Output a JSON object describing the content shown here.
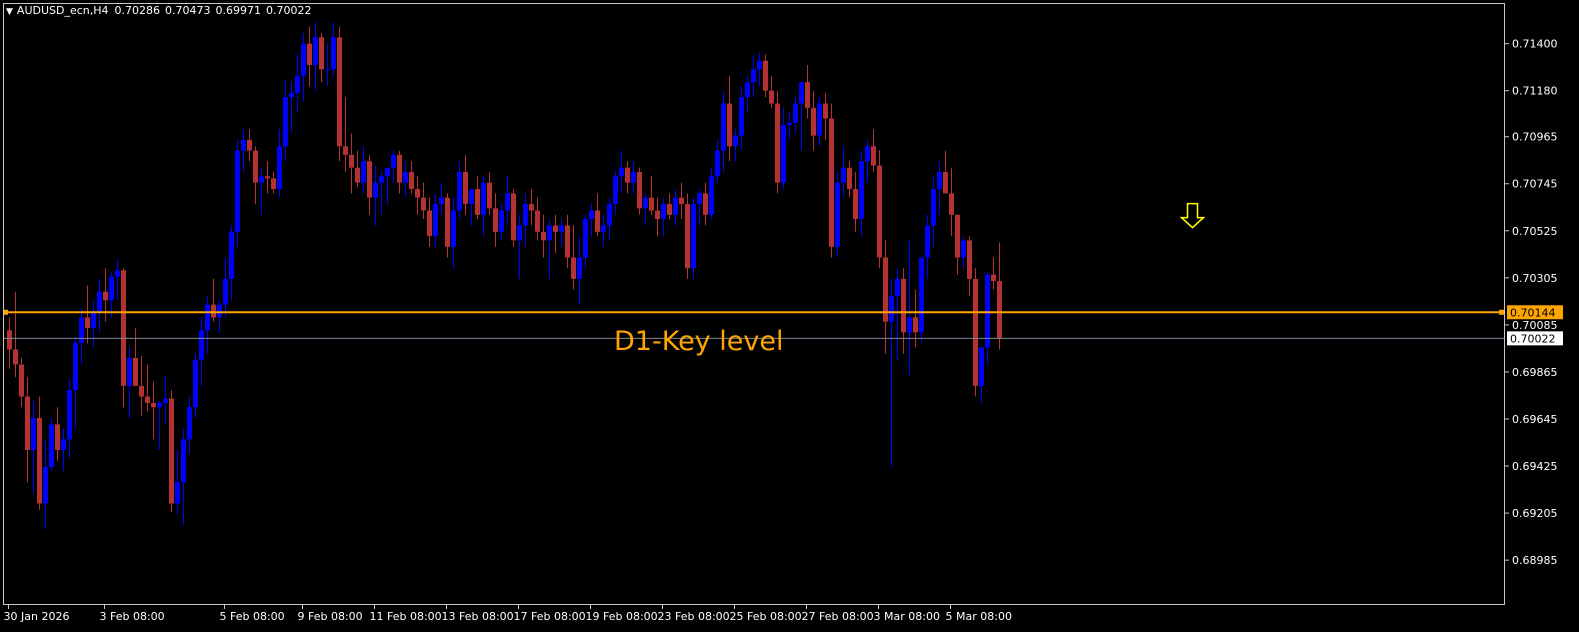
{
  "header": {
    "symbol": "AUDUSD_ecn,H4",
    "open": "0.70286",
    "high": "0.70473",
    "low": "0.69971",
    "close": "0.70022",
    "collapse_icon": "triangle-down-icon"
  },
  "colors": {
    "background": "#000000",
    "frame": "#c8c8c8",
    "bull": "#0000ff",
    "bear": "#b43232",
    "key_level": "#ffa500",
    "current_price": "#7d8a99",
    "arrow": "#ffff00",
    "text": "#ffffff"
  },
  "annotation": {
    "key_level_text": "D1-Key level",
    "arrow_icon": "arrow-down-outline-icon"
  },
  "price_tags": {
    "key_level": "0.70144",
    "current": "0.70022"
  },
  "chart_data": {
    "type": "candlestick",
    "title": "AUDUSD_ecn,H4",
    "ylim": [
      0.6878,
      0.7159
    ],
    "y_ticks": [
      "0.71400",
      "0.71180",
      "0.70965",
      "0.70745",
      "0.70525",
      "0.70305",
      "0.70085",
      "0.69865",
      "0.69645",
      "0.69425",
      "0.69205",
      "0.68985"
    ],
    "x_ticks": [
      "30 Jan 2026",
      "3 Feb 08:00",
      "5 Feb 08:00",
      "9 Feb 08:00",
      "11 Feb 08:00",
      "13 Feb 08:00",
      "17 Feb 08:00",
      "19 Feb 08:00",
      "23 Feb 08:00",
      "25 Feb 08:00",
      "27 Feb 08:00",
      "3 Mar 08:00",
      "5 Mar 08:00"
    ],
    "x_tick_bar_index": [
      0,
      16,
      36,
      49,
      61,
      73,
      85,
      97,
      109,
      121,
      133,
      145,
      157
    ],
    "grid": false,
    "horizontal_lines": [
      {
        "name": "D1-Key level",
        "price": 0.70144
      },
      {
        "name": "current price",
        "price": 0.70022
      }
    ],
    "arrow_marker": {
      "bar_index": 198,
      "price": 0.7054,
      "direction": "down"
    },
    "candles": [
      [
        0.7006,
        0.7012,
        0.6988,
        0.6997
      ],
      [
        0.6997,
        0.7024,
        0.6984,
        0.699
      ],
      [
        0.699,
        0.6993,
        0.697,
        0.6975
      ],
      [
        0.6975,
        0.6984,
        0.6935,
        0.695
      ],
      [
        0.695,
        0.6973,
        0.693,
        0.6965
      ],
      [
        0.6965,
        0.6975,
        0.6922,
        0.6925
      ],
      [
        0.6925,
        0.6955,
        0.6913,
        0.6942
      ],
      [
        0.6942,
        0.6965,
        0.694,
        0.6962
      ],
      [
        0.6962,
        0.697,
        0.6945,
        0.695
      ],
      [
        0.695,
        0.696,
        0.694,
        0.6955
      ],
      [
        0.6955,
        0.6983,
        0.6946,
        0.6978
      ],
      [
        0.6978,
        0.7003,
        0.696,
        0.7
      ],
      [
        0.7,
        0.7016,
        0.699,
        0.7012
      ],
      [
        0.7012,
        0.7027,
        0.7,
        0.7007
      ],
      [
        0.7007,
        0.702,
        0.6998,
        0.7015
      ],
      [
        0.7015,
        0.703,
        0.7005,
        0.7024
      ],
      [
        0.7024,
        0.7035,
        0.701,
        0.702
      ],
      [
        0.702,
        0.7033,
        0.7012,
        0.7031
      ],
      [
        0.7031,
        0.7039,
        0.702,
        0.7034
      ],
      [
        0.7034,
        0.7035,
        0.697,
        0.698
      ],
      [
        0.698,
        0.6998,
        0.6965,
        0.6993
      ],
      [
        0.6993,
        0.7007,
        0.6982,
        0.698
      ],
      [
        0.698,
        0.6994,
        0.6966,
        0.6975
      ],
      [
        0.6975,
        0.699,
        0.6968,
        0.6972
      ],
      [
        0.6972,
        0.6982,
        0.6955,
        0.697
      ],
      [
        0.697,
        0.6973,
        0.695,
        0.6972
      ],
      [
        0.6972,
        0.6985,
        0.6962,
        0.6974
      ],
      [
        0.6974,
        0.6978,
        0.6921,
        0.6925
      ],
      [
        0.6925,
        0.695,
        0.692,
        0.6935
      ],
      [
        0.6935,
        0.696,
        0.6915,
        0.6955
      ],
      [
        0.6955,
        0.6975,
        0.6948,
        0.697
      ],
      [
        0.697,
        0.6995,
        0.6965,
        0.6992
      ],
      [
        0.6992,
        0.7012,
        0.698,
        0.7006
      ],
      [
        0.7006,
        0.7022,
        0.6995,
        0.7018
      ],
      [
        0.7018,
        0.703,
        0.701,
        0.7012
      ],
      [
        0.7012,
        0.702,
        0.7005,
        0.7018
      ],
      [
        0.7018,
        0.704,
        0.7012,
        0.703
      ],
      [
        0.703,
        0.7055,
        0.702,
        0.7052
      ],
      [
        0.7052,
        0.7095,
        0.7045,
        0.709
      ],
      [
        0.709,
        0.71,
        0.708,
        0.7095
      ],
      [
        0.7095,
        0.71,
        0.7085,
        0.709
      ],
      [
        0.709,
        0.7092,
        0.7065,
        0.7075
      ],
      [
        0.7075,
        0.7082,
        0.706,
        0.7078
      ],
      [
        0.7078,
        0.7085,
        0.707,
        0.7077
      ],
      [
        0.7077,
        0.708,
        0.707,
        0.7072
      ],
      [
        0.7072,
        0.71,
        0.7068,
        0.7092
      ],
      [
        0.7092,
        0.7123,
        0.7085,
        0.7115
      ],
      [
        0.7115,
        0.7122,
        0.7098,
        0.7117
      ],
      [
        0.7117,
        0.7135,
        0.7108,
        0.7125
      ],
      [
        0.7125,
        0.7145,
        0.7113,
        0.714
      ],
      [
        0.714,
        0.7148,
        0.712,
        0.713
      ],
      [
        0.713,
        0.715,
        0.7118,
        0.7143
      ],
      [
        0.7143,
        0.7145,
        0.7122,
        0.7128
      ],
      [
        0.7128,
        0.714,
        0.712,
        0.7128
      ],
      [
        0.7128,
        0.715,
        0.7125,
        0.7143
      ],
      [
        0.7143,
        0.7148,
        0.7085,
        0.7092
      ],
      [
        0.7092,
        0.7115,
        0.708,
        0.7088
      ],
      [
        0.7088,
        0.7098,
        0.707,
        0.7082
      ],
      [
        0.7082,
        0.709,
        0.7073,
        0.7075
      ],
      [
        0.7075,
        0.7092,
        0.707,
        0.7085
      ],
      [
        0.7085,
        0.7088,
        0.706,
        0.7068
      ],
      [
        0.7068,
        0.7083,
        0.7055,
        0.7075
      ],
      [
        0.7075,
        0.708,
        0.706,
        0.7078
      ],
      [
        0.7078,
        0.7082,
        0.7065,
        0.7082
      ],
      [
        0.7082,
        0.709,
        0.7075,
        0.7088
      ],
      [
        0.7088,
        0.709,
        0.707,
        0.7075
      ],
      [
        0.7075,
        0.7085,
        0.7068,
        0.708
      ],
      [
        0.708,
        0.7085,
        0.707,
        0.7072
      ],
      [
        0.7072,
        0.7078,
        0.706,
        0.7068
      ],
      [
        0.7068,
        0.7075,
        0.7058,
        0.7062
      ],
      [
        0.7062,
        0.7068,
        0.7045,
        0.705
      ],
      [
        0.705,
        0.707,
        0.7045,
        0.7065
      ],
      [
        0.7065,
        0.7075,
        0.706,
        0.7068
      ],
      [
        0.7068,
        0.707,
        0.704,
        0.7045
      ],
      [
        0.7045,
        0.7068,
        0.7035,
        0.7062
      ],
      [
        0.7062,
        0.7085,
        0.7058,
        0.708
      ],
      [
        0.708,
        0.7088,
        0.706,
        0.7065
      ],
      [
        0.7065,
        0.7072,
        0.7055,
        0.7072
      ],
      [
        0.7072,
        0.7078,
        0.7058,
        0.706
      ],
      [
        0.706,
        0.7078,
        0.705,
        0.7075
      ],
      [
        0.7075,
        0.708,
        0.706,
        0.7063
      ],
      [
        0.7063,
        0.707,
        0.7045,
        0.7052
      ],
      [
        0.7052,
        0.7065,
        0.7048,
        0.7062
      ],
      [
        0.7062,
        0.7078,
        0.7055,
        0.707
      ],
      [
        0.707,
        0.7072,
        0.7045,
        0.7048
      ],
      [
        0.7048,
        0.706,
        0.703,
        0.7055
      ],
      [
        0.7055,
        0.707,
        0.7045,
        0.7065
      ],
      [
        0.7065,
        0.7072,
        0.7055,
        0.7062
      ],
      [
        0.7062,
        0.7068,
        0.7048,
        0.7052
      ],
      [
        0.7052,
        0.706,
        0.704,
        0.7048
      ],
      [
        0.7048,
        0.7058,
        0.703,
        0.7055
      ],
      [
        0.7055,
        0.706,
        0.7042,
        0.7052
      ],
      [
        0.7052,
        0.7058,
        0.7045,
        0.7055
      ],
      [
        0.7055,
        0.706,
        0.7035,
        0.704
      ],
      [
        0.704,
        0.7055,
        0.7025,
        0.703
      ],
      [
        0.703,
        0.705,
        0.7018,
        0.704
      ],
      [
        0.704,
        0.706,
        0.7035,
        0.7058
      ],
      [
        0.7058,
        0.7065,
        0.705,
        0.7062
      ],
      [
        0.7062,
        0.707,
        0.705,
        0.7052
      ],
      [
        0.7052,
        0.706,
        0.7045,
        0.7055
      ],
      [
        0.7055,
        0.7068,
        0.7048,
        0.7065
      ],
      [
        0.7065,
        0.708,
        0.706,
        0.7078
      ],
      [
        0.7078,
        0.709,
        0.707,
        0.7082
      ],
      [
        0.7082,
        0.7085,
        0.707,
        0.7075
      ],
      [
        0.7075,
        0.7085,
        0.707,
        0.708
      ],
      [
        0.708,
        0.7082,
        0.706,
        0.7063
      ],
      [
        0.7063,
        0.707,
        0.7055,
        0.7068
      ],
      [
        0.7068,
        0.7078,
        0.706,
        0.7062
      ],
      [
        0.7062,
        0.7068,
        0.705,
        0.7058
      ],
      [
        0.7058,
        0.7068,
        0.705,
        0.7065
      ],
      [
        0.7065,
        0.707,
        0.7058,
        0.706
      ],
      [
        0.706,
        0.7072,
        0.7055,
        0.7068
      ],
      [
        0.7068,
        0.7075,
        0.7058,
        0.7065
      ],
      [
        0.7065,
        0.707,
        0.703,
        0.7035
      ],
      [
        0.7035,
        0.7068,
        0.703,
        0.7065
      ],
      [
        0.7065,
        0.7072,
        0.7055,
        0.707
      ],
      [
        0.707,
        0.7075,
        0.7055,
        0.706
      ],
      [
        0.706,
        0.7082,
        0.7058,
        0.7078
      ],
      [
        0.7078,
        0.7095,
        0.7075,
        0.709
      ],
      [
        0.709,
        0.7118,
        0.708,
        0.7112
      ],
      [
        0.7112,
        0.7125,
        0.7085,
        0.7092
      ],
      [
        0.7092,
        0.71,
        0.7085,
        0.7097
      ],
      [
        0.7097,
        0.712,
        0.709,
        0.7115
      ],
      [
        0.7115,
        0.7125,
        0.7108,
        0.7122
      ],
      [
        0.7122,
        0.7135,
        0.7115,
        0.7128
      ],
      [
        0.7128,
        0.7136,
        0.712,
        0.7132
      ],
      [
        0.7132,
        0.7135,
        0.7115,
        0.7118
      ],
      [
        0.7118,
        0.7125,
        0.711,
        0.7112
      ],
      [
        0.7112,
        0.7118,
        0.707,
        0.7075
      ],
      [
        0.7075,
        0.711,
        0.7072,
        0.7102
      ],
      [
        0.7102,
        0.7108,
        0.7095,
        0.7103
      ],
      [
        0.7103,
        0.7115,
        0.7098,
        0.7112
      ],
      [
        0.7112,
        0.7122,
        0.709,
        0.7122
      ],
      [
        0.7122,
        0.713,
        0.7105,
        0.711
      ],
      [
        0.711,
        0.7118,
        0.709,
        0.7097
      ],
      [
        0.7097,
        0.7115,
        0.7092,
        0.7112
      ],
      [
        0.7112,
        0.7117,
        0.7095,
        0.7105
      ],
      [
        0.7105,
        0.7112,
        0.704,
        0.7045
      ],
      [
        0.7045,
        0.708,
        0.704,
        0.7075
      ],
      [
        0.7075,
        0.7092,
        0.7068,
        0.7082
      ],
      [
        0.7082,
        0.7085,
        0.7068,
        0.7072
      ],
      [
        0.7072,
        0.708,
        0.7052,
        0.7058
      ],
      [
        0.7058,
        0.709,
        0.705,
        0.7085
      ],
      [
        0.7085,
        0.7095,
        0.7075,
        0.7092
      ],
      [
        0.7092,
        0.71,
        0.708,
        0.7083
      ],
      [
        0.7083,
        0.709,
        0.7035,
        0.704
      ],
      [
        0.704,
        0.7048,
        0.6995,
        0.701
      ],
      [
        0.701,
        0.703,
        0.6942,
        0.7022
      ],
      [
        0.7022,
        0.7035,
        0.6992,
        0.703
      ],
      [
        0.703,
        0.7035,
        0.6995,
        0.7005
      ],
      [
        0.7005,
        0.7048,
        0.6985,
        0.7012
      ],
      [
        0.7012,
        0.7025,
        0.6998,
        0.7005
      ],
      [
        0.7005,
        0.704,
        0.7,
        0.704
      ],
      [
        0.704,
        0.706,
        0.703,
        0.7055
      ],
      [
        0.7055,
        0.7078,
        0.7045,
        0.7072
      ],
      [
        0.7072,
        0.7085,
        0.706,
        0.708
      ],
      [
        0.708,
        0.709,
        0.707,
        0.707
      ],
      [
        0.707,
        0.7082,
        0.705,
        0.706
      ],
      [
        0.706,
        0.706,
        0.7032,
        0.704
      ],
      [
        0.704,
        0.705,
        0.7035,
        0.7048
      ],
      [
        0.7048,
        0.705,
        0.7022,
        0.703
      ],
      [
        0.703,
        0.7035,
        0.6975,
        0.698
      ],
      [
        0.698,
        0.699,
        0.6972,
        0.6998
      ],
      [
        0.6998,
        0.7033,
        0.699,
        0.7032
      ],
      [
        0.7032,
        0.704,
        0.7025,
        0.7029
      ],
      [
        0.7029,
        0.7047,
        0.6997,
        0.7002
      ]
    ]
  }
}
